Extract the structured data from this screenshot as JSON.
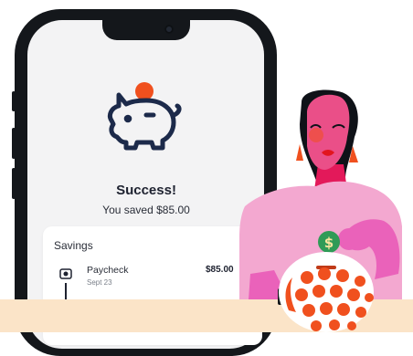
{
  "success_screen": {
    "title": "Success!",
    "message": "You saved $85.00"
  },
  "savings_card": {
    "title": "Savings",
    "transactions": [
      {
        "name": "Paycheck",
        "date": "Sept 23",
        "amount": "$85.00"
      }
    ]
  },
  "illustration": {
    "coin_symbol": "$"
  },
  "colors": {
    "accent_orange": "#f0501e",
    "navy": "#1c2a4a",
    "pink_shirt": "#f3a8d0",
    "skin": "#ea4f88",
    "coin_green": "#2f9b57",
    "floor_peach": "#fbe4c8"
  }
}
